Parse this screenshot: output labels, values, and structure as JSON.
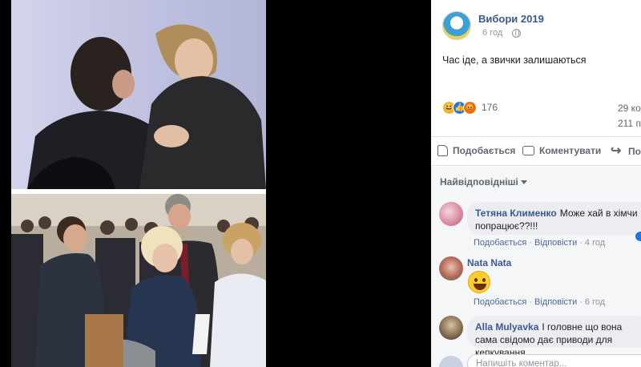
{
  "post": {
    "page_name": "Вибори 2019",
    "time": "6 год",
    "text": "Час іде, а звички залишаються",
    "reaction_count": "176",
    "comments_count": "29 ко",
    "shares_count": "211 п",
    "reactions": [
      "haha",
      "like",
      "angry"
    ]
  },
  "actions": {
    "like": "Подобається",
    "comment": "Коментувати",
    "share": "По"
  },
  "sort": {
    "label": "Найвідповідніші"
  },
  "comments": [
    {
      "author": "Тетяна Клименко",
      "text": "Може хай в хімчи попрацює??!!!",
      "like_label": "Подобається",
      "reply_label": "Відповісти",
      "time": "4 год"
    },
    {
      "author": "Nata Nata",
      "emoji": "grinning-face",
      "like_label": "Подобається",
      "reply_label": "Відповісти",
      "time": "6 год"
    },
    {
      "author": "Alla Mulyavka",
      "text": "І головне що вона сама свідомо дає приводи для кепкування"
    }
  ],
  "composer": {
    "placeholder": "Напишіть коментар..."
  },
  "colors": {
    "link": "#365899",
    "muted": "#90949c",
    "panel_bg": "#f5f6f7"
  }
}
